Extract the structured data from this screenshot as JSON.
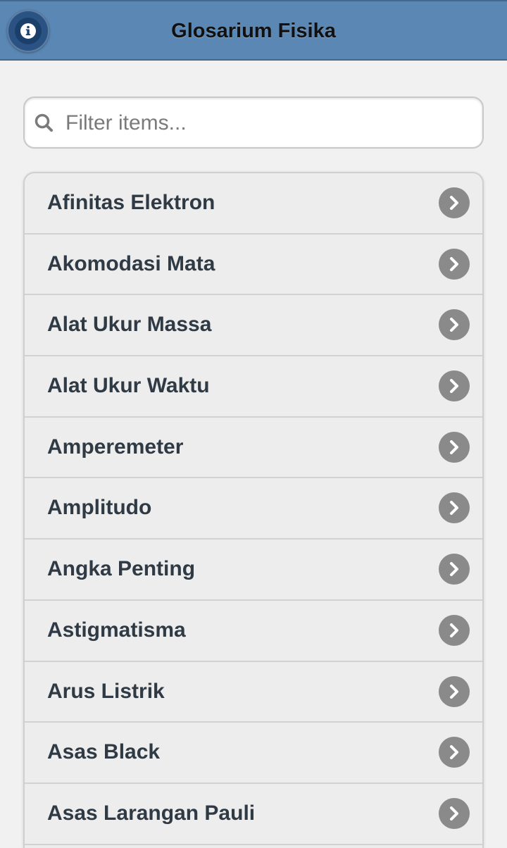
{
  "header": {
    "title": "Glosarium Fisika",
    "info_icon": "info-icon"
  },
  "search": {
    "placeholder": "Filter items...",
    "value": "",
    "icon": "search-icon"
  },
  "colors": {
    "header_bg": "#5a87b4",
    "info_button": "#1a3f6b",
    "chevron_bg": "#8a8a8a",
    "item_text": "#2f3a44"
  },
  "list": {
    "items": [
      {
        "label": "Afinitas Elektron"
      },
      {
        "label": "Akomodasi Mata"
      },
      {
        "label": "Alat Ukur Massa"
      },
      {
        "label": "Alat Ukur Waktu"
      },
      {
        "label": "Amperemeter"
      },
      {
        "label": "Amplitudo"
      },
      {
        "label": "Angka Penting"
      },
      {
        "label": "Astigmatisma"
      },
      {
        "label": "Arus Listrik"
      },
      {
        "label": "Asas Black"
      },
      {
        "label": "Asas Larangan Pauli"
      }
    ],
    "item_icon": "chevron-right-icon"
  }
}
